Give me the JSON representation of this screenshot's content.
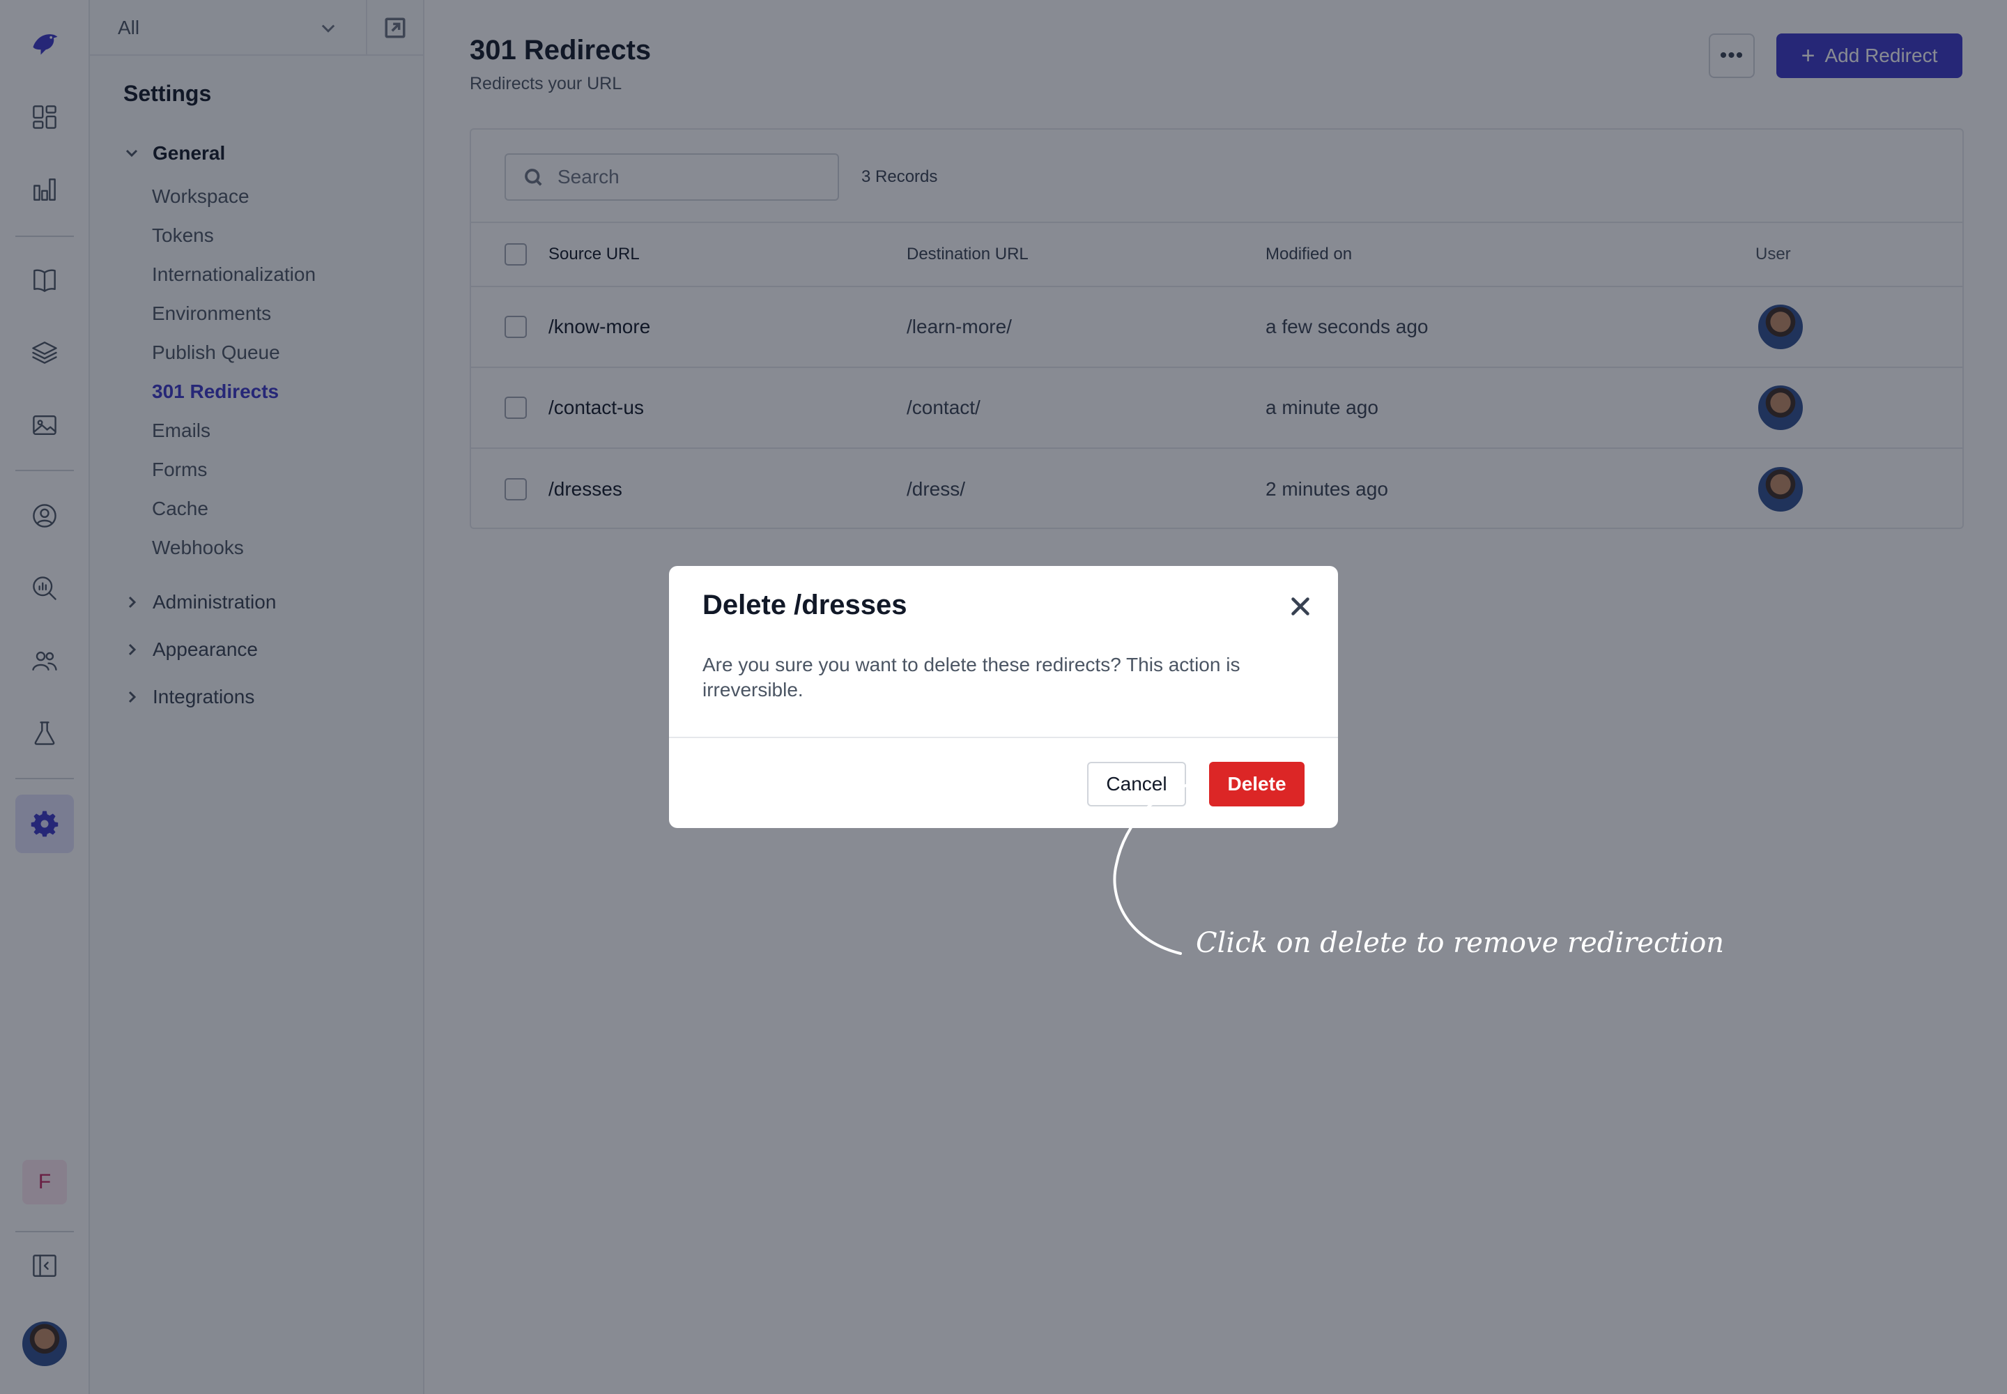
{
  "rail": {
    "icons": [
      "bird-logo-icon",
      "dashboard-grid-icon",
      "bar-chart-icon",
      "book-icon",
      "layers-icon",
      "image-icon",
      "user-circle-icon",
      "search-analytics-icon",
      "team-icon",
      "flask-icon",
      "gear-icon",
      "collapse-sidebar-icon"
    ],
    "workspace_initial": "F",
    "accent": "#3b36c6"
  },
  "sidebar": {
    "workspace_select": "All",
    "title": "Settings",
    "general": {
      "label": "General",
      "items": [
        "Workspace",
        "Tokens",
        "Internationalization",
        "Environments",
        "Publish Queue",
        "301 Redirects",
        "Emails",
        "Forms",
        "Cache",
        "Webhooks"
      ],
      "active": "301 Redirects"
    },
    "groups": [
      "Administration",
      "Appearance",
      "Integrations"
    ]
  },
  "header": {
    "title": "301 Redirects",
    "subtitle": "Redirects your URL",
    "more_label": "•••",
    "add_label": "Add Redirect",
    "add_icon": "+"
  },
  "search": {
    "placeholder": "Search",
    "value": ""
  },
  "records_count": "3 Records",
  "table": {
    "columns": [
      "Source URL",
      "Destination URL",
      "Modified on",
      "User"
    ],
    "rows": [
      {
        "source": "/know-more",
        "destination": "/learn-more/",
        "modified": "a few seconds ago"
      },
      {
        "source": "/contact-us",
        "destination": "/contact/",
        "modified": "a minute ago"
      },
      {
        "source": "/dresses",
        "destination": "/dress/",
        "modified": "2 minutes ago"
      }
    ]
  },
  "modal": {
    "title": "Delete /dresses",
    "body": "Are you sure you want to delete these redirects? This action is irreversible.",
    "cancel_label": "Cancel",
    "delete_label": "Delete",
    "delete_color": "#dc2626"
  },
  "annotation": {
    "text": "Click on delete to remove redirection"
  }
}
